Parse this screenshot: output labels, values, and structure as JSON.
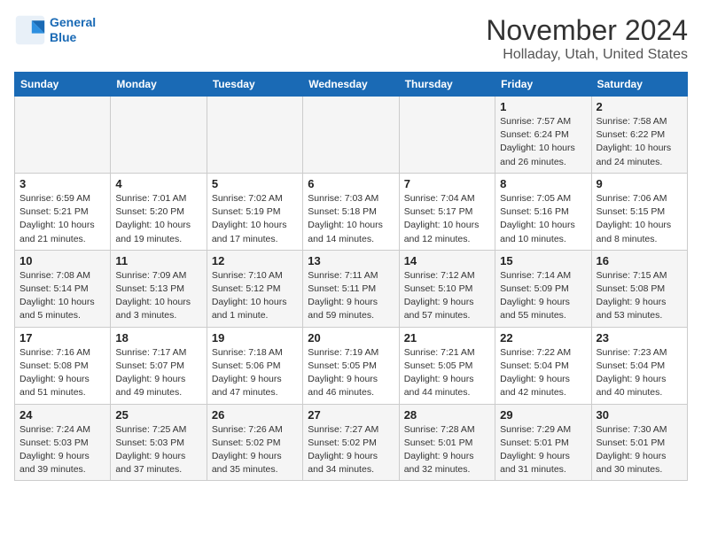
{
  "logo": {
    "line1": "General",
    "line2": "Blue"
  },
  "title": "November 2024",
  "subtitle": "Holladay, Utah, United States",
  "weekdays": [
    "Sunday",
    "Monday",
    "Tuesday",
    "Wednesday",
    "Thursday",
    "Friday",
    "Saturday"
  ],
  "weeks": [
    [
      {
        "day": "",
        "info": ""
      },
      {
        "day": "",
        "info": ""
      },
      {
        "day": "",
        "info": ""
      },
      {
        "day": "",
        "info": ""
      },
      {
        "day": "",
        "info": ""
      },
      {
        "day": "1",
        "info": "Sunrise: 7:57 AM\nSunset: 6:24 PM\nDaylight: 10 hours\nand 26 minutes."
      },
      {
        "day": "2",
        "info": "Sunrise: 7:58 AM\nSunset: 6:22 PM\nDaylight: 10 hours\nand 24 minutes."
      }
    ],
    [
      {
        "day": "3",
        "info": "Sunrise: 6:59 AM\nSunset: 5:21 PM\nDaylight: 10 hours\nand 21 minutes."
      },
      {
        "day": "4",
        "info": "Sunrise: 7:01 AM\nSunset: 5:20 PM\nDaylight: 10 hours\nand 19 minutes."
      },
      {
        "day": "5",
        "info": "Sunrise: 7:02 AM\nSunset: 5:19 PM\nDaylight: 10 hours\nand 17 minutes."
      },
      {
        "day": "6",
        "info": "Sunrise: 7:03 AM\nSunset: 5:18 PM\nDaylight: 10 hours\nand 14 minutes."
      },
      {
        "day": "7",
        "info": "Sunrise: 7:04 AM\nSunset: 5:17 PM\nDaylight: 10 hours\nand 12 minutes."
      },
      {
        "day": "8",
        "info": "Sunrise: 7:05 AM\nSunset: 5:16 PM\nDaylight: 10 hours\nand 10 minutes."
      },
      {
        "day": "9",
        "info": "Sunrise: 7:06 AM\nSunset: 5:15 PM\nDaylight: 10 hours\nand 8 minutes."
      }
    ],
    [
      {
        "day": "10",
        "info": "Sunrise: 7:08 AM\nSunset: 5:14 PM\nDaylight: 10 hours\nand 5 minutes."
      },
      {
        "day": "11",
        "info": "Sunrise: 7:09 AM\nSunset: 5:13 PM\nDaylight: 10 hours\nand 3 minutes."
      },
      {
        "day": "12",
        "info": "Sunrise: 7:10 AM\nSunset: 5:12 PM\nDaylight: 10 hours\nand 1 minute."
      },
      {
        "day": "13",
        "info": "Sunrise: 7:11 AM\nSunset: 5:11 PM\nDaylight: 9 hours\nand 59 minutes."
      },
      {
        "day": "14",
        "info": "Sunrise: 7:12 AM\nSunset: 5:10 PM\nDaylight: 9 hours\nand 57 minutes."
      },
      {
        "day": "15",
        "info": "Sunrise: 7:14 AM\nSunset: 5:09 PM\nDaylight: 9 hours\nand 55 minutes."
      },
      {
        "day": "16",
        "info": "Sunrise: 7:15 AM\nSunset: 5:08 PM\nDaylight: 9 hours\nand 53 minutes."
      }
    ],
    [
      {
        "day": "17",
        "info": "Sunrise: 7:16 AM\nSunset: 5:08 PM\nDaylight: 9 hours\nand 51 minutes."
      },
      {
        "day": "18",
        "info": "Sunrise: 7:17 AM\nSunset: 5:07 PM\nDaylight: 9 hours\nand 49 minutes."
      },
      {
        "day": "19",
        "info": "Sunrise: 7:18 AM\nSunset: 5:06 PM\nDaylight: 9 hours\nand 47 minutes."
      },
      {
        "day": "20",
        "info": "Sunrise: 7:19 AM\nSunset: 5:05 PM\nDaylight: 9 hours\nand 46 minutes."
      },
      {
        "day": "21",
        "info": "Sunrise: 7:21 AM\nSunset: 5:05 PM\nDaylight: 9 hours\nand 44 minutes."
      },
      {
        "day": "22",
        "info": "Sunrise: 7:22 AM\nSunset: 5:04 PM\nDaylight: 9 hours\nand 42 minutes."
      },
      {
        "day": "23",
        "info": "Sunrise: 7:23 AM\nSunset: 5:04 PM\nDaylight: 9 hours\nand 40 minutes."
      }
    ],
    [
      {
        "day": "24",
        "info": "Sunrise: 7:24 AM\nSunset: 5:03 PM\nDaylight: 9 hours\nand 39 minutes."
      },
      {
        "day": "25",
        "info": "Sunrise: 7:25 AM\nSunset: 5:03 PM\nDaylight: 9 hours\nand 37 minutes."
      },
      {
        "day": "26",
        "info": "Sunrise: 7:26 AM\nSunset: 5:02 PM\nDaylight: 9 hours\nand 35 minutes."
      },
      {
        "day": "27",
        "info": "Sunrise: 7:27 AM\nSunset: 5:02 PM\nDaylight: 9 hours\nand 34 minutes."
      },
      {
        "day": "28",
        "info": "Sunrise: 7:28 AM\nSunset: 5:01 PM\nDaylight: 9 hours\nand 32 minutes."
      },
      {
        "day": "29",
        "info": "Sunrise: 7:29 AM\nSunset: 5:01 PM\nDaylight: 9 hours\nand 31 minutes."
      },
      {
        "day": "30",
        "info": "Sunrise: 7:30 AM\nSunset: 5:01 PM\nDaylight: 9 hours\nand 30 minutes."
      }
    ]
  ]
}
